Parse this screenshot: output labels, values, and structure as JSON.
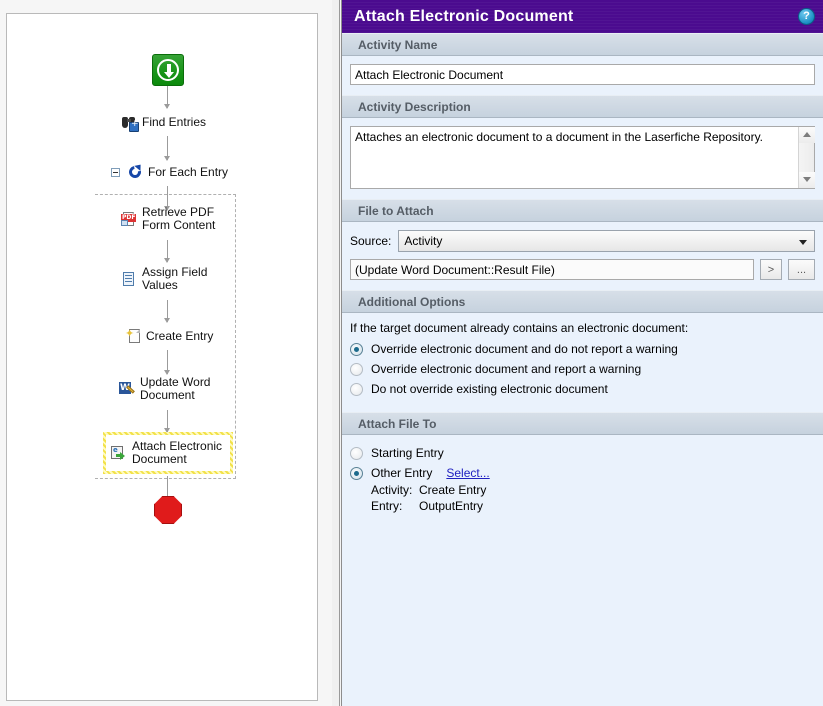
{
  "workflow": {
    "start_node": {
      "name": "start-node",
      "icon": "download-arrow-icon"
    },
    "stop_node": {
      "name": "stop-node",
      "icon": "stop-octagon-icon"
    },
    "nodes": [
      {
        "label": "Find Entries",
        "icon": "binoculars-icon",
        "selected": false
      },
      {
        "label": "For Each Entry",
        "icon": "loop-arrow-icon",
        "selected": false,
        "expander": "collapse-box"
      },
      {
        "label_line1": "Retrieve PDF",
        "label_line2": "Form Content",
        "icon": "pdf-form-icon",
        "selected": false
      },
      {
        "label_line1": "Assign Field",
        "label_line2": "Values",
        "icon": "field-values-icon",
        "selected": false
      },
      {
        "label": "Create Entry",
        "icon": "new-entry-icon",
        "selected": false
      },
      {
        "label_line1": "Update Word",
        "label_line2": "Document",
        "icon": "word-document-icon",
        "selected": false
      },
      {
        "label_line1": "Attach Electronic",
        "label_line2": "Document",
        "icon": "attach-edoc-icon",
        "selected": true
      }
    ]
  },
  "dialog": {
    "title": "Attach Electronic Document",
    "help_label": "?",
    "title_bar_color": "#4b0b8f",
    "sections": {
      "activity_name": {
        "header": "Activity Name",
        "value": "Attach Electronic Document"
      },
      "activity_description": {
        "header": "Activity Description",
        "value": "Attaches an electronic document to a document in the Laserfiche Repository."
      },
      "file_to_attach": {
        "header": "File to Attach",
        "source_label": "Source:",
        "source_value": "Activity",
        "source_options": [
          "Activity"
        ],
        "file_value": "(Update Word Document::Result File)",
        "token_button": ">",
        "browse_button": "..."
      },
      "additional_options": {
        "header": "Additional Options",
        "hint": "If the target document already contains an electronic document:",
        "options": [
          {
            "label": "Override electronic document and do not report a warning",
            "selected": true
          },
          {
            "label": "Override electronic document and report a warning",
            "selected": false
          },
          {
            "label": "Do not override existing electronic document",
            "selected": false
          }
        ]
      },
      "attach_file_to": {
        "header": "Attach File To",
        "options": [
          {
            "label": "Starting Entry",
            "selected": false
          },
          {
            "label": "Other Entry",
            "selected": true
          }
        ],
        "select_link": "Select...",
        "details": [
          {
            "key": "Activity:",
            "value": "Create Entry"
          },
          {
            "key": "Entry:",
            "value": "OutputEntry"
          }
        ]
      }
    }
  }
}
